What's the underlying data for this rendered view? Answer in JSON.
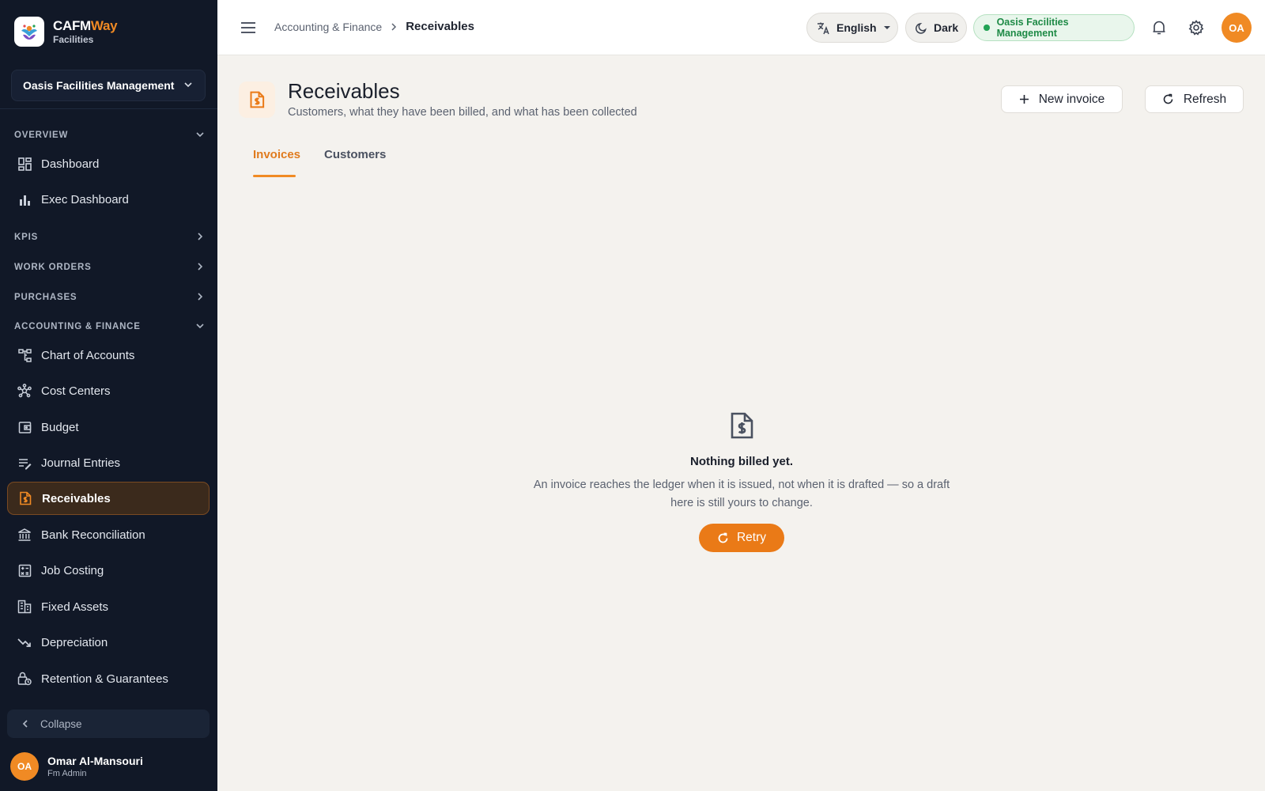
{
  "brand": {
    "name_main": "CAFM",
    "name_accent": "Way",
    "subtitle": "Facilities"
  },
  "sidebar": {
    "org_selector": "Oasis Facilities Management",
    "sections": {
      "overview": "OVERVIEW",
      "kpis": "KPIS",
      "work_orders": "WORK ORDERS",
      "purchases": "PURCHASES",
      "accounting": "ACCOUNTING & FINANCE"
    },
    "items": {
      "dashboard": "Dashboard",
      "exec_dashboard": "Exec Dashboard",
      "chart_of_accounts": "Chart of Accounts",
      "cost_centers": "Cost Centers",
      "budget": "Budget",
      "journal_entries": "Journal Entries",
      "receivables": "Receivables",
      "bank_reconciliation": "Bank Reconciliation",
      "job_costing": "Job Costing",
      "fixed_assets": "Fixed Assets",
      "depreciation": "Depreciation",
      "retention": "Retention & Guarantees"
    },
    "active_item": "Receivables",
    "collapse_label": "Collapse",
    "user": {
      "initials": "OA",
      "name": "Omar Al-Mansouri",
      "role": "Fm Admin"
    }
  },
  "topbar": {
    "breadcrumb_parent": "Accounting & Finance",
    "breadcrumb_current": "Receivables",
    "language": "English",
    "theme_toggle": "Dark",
    "org_badge": "Oasis Facilities Management",
    "avatar_initials": "OA"
  },
  "page": {
    "title": "Receivables",
    "subtitle": "Customers, what they have been billed, and what has been collected",
    "new_button": "New invoice",
    "refresh_button": "Refresh",
    "tabs": [
      "Invoices",
      "Customers"
    ],
    "active_tab": "Invoices"
  },
  "empty_state": {
    "title": "Nothing billed yet.",
    "description": "An invoice reaches the ledger when it is issued, not when it is drafted — so a draft here is still yours to change.",
    "retry_label": "Retry"
  },
  "colors": {
    "accent": "#f08a24",
    "sidebar_bg": "#111827",
    "page_bg": "#f4f2ee",
    "success": "#22a355"
  }
}
